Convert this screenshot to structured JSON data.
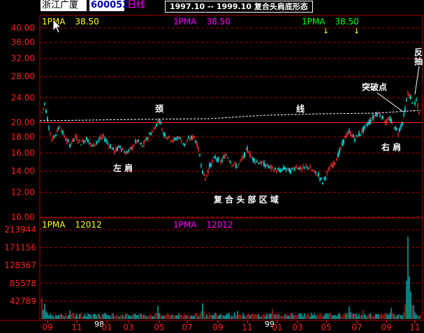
{
  "header": {
    "stock_name": "浙江广厦",
    "stock_code": "600052",
    "period": "日线",
    "range_title": "1997.10  --  1999.10   复合头肩底形态"
  },
  "colors": {
    "up": "#ff3030",
    "down": "#00ffff",
    "grid": "#aa0000",
    "ma_yellow": "#ffff00",
    "ma_magenta": "#ff00ff",
    "ma_green": "#00ff00"
  },
  "chart_data": [
    {
      "type": "candlestick",
      "y_ticks": [
        "40.00",
        "36.00",
        "32.00",
        "28.00",
        "24.00",
        "20.00",
        "18.00",
        "16.00",
        "14.00",
        "12.00",
        "10.00"
      ],
      "y_values": [
        40,
        36,
        32,
        28,
        24,
        20,
        18,
        16,
        14,
        12,
        10
      ],
      "scale": "log",
      "ylim": [
        10,
        40
      ],
      "ma_labels": [
        {
          "name": "1PMA",
          "value": "38.50",
          "color": "yellow"
        },
        {
          "name": "1PMA",
          "value": "38.50",
          "color": "magenta"
        },
        {
          "name": "1PMA",
          "value": "38.50",
          "color": "green"
        }
      ],
      "neckline_label_1": "颈",
      "neckline_label_2": "线",
      "annotations": {
        "left_shoulder": "左 肩",
        "right_shoulder": "右 肩",
        "compound_head": "复 合 头 部 区 域",
        "breakout": "突破点",
        "pullback": "反抽"
      },
      "approx_price_path": [
        [
          0,
          21.5
        ],
        [
          4,
          23.0
        ],
        [
          9,
          20.0
        ],
        [
          14,
          17.5
        ],
        [
          20,
          18.5
        ],
        [
          26,
          19.5
        ],
        [
          32,
          18.0
        ],
        [
          40,
          17.0
        ],
        [
          48,
          18.0
        ],
        [
          56,
          17.2
        ],
        [
          64,
          17.8
        ],
        [
          72,
          16.8
        ],
        [
          80,
          17.5
        ],
        [
          88,
          18.0
        ],
        [
          96,
          17.0
        ],
        [
          104,
          16.2
        ],
        [
          112,
          16.8
        ],
        [
          120,
          16.0
        ],
        [
          128,
          16.5
        ],
        [
          136,
          17.5
        ],
        [
          144,
          16.8
        ],
        [
          152,
          18.0
        ],
        [
          160,
          19.0
        ],
        [
          168,
          20.5
        ],
        [
          174,
          18.5
        ],
        [
          180,
          18.0
        ],
        [
          188,
          17.5
        ],
        [
          196,
          18.0
        ],
        [
          204,
          17.0
        ],
        [
          212,
          17.8
        ],
        [
          218,
          18.0
        ],
        [
          224,
          16.5
        ],
        [
          230,
          14.0
        ],
        [
          234,
          13.2
        ],
        [
          240,
          14.5
        ],
        [
          248,
          15.5
        ],
        [
          256,
          15.0
        ],
        [
          264,
          15.8
        ],
        [
          272,
          14.8
        ],
        [
          280,
          14.5
        ],
        [
          288,
          15.5
        ],
        [
          294,
          16.5
        ],
        [
          300,
          15.5
        ],
        [
          308,
          15.0
        ],
        [
          316,
          14.8
        ],
        [
          324,
          14.5
        ],
        [
          332,
          14.2
        ],
        [
          340,
          14.0
        ],
        [
          348,
          14.3
        ],
        [
          356,
          14.0
        ],
        [
          364,
          14.5
        ],
        [
          372,
          14.2
        ],
        [
          380,
          14.5
        ],
        [
          388,
          14.0
        ],
        [
          396,
          13.6
        ],
        [
          402,
          12.9
        ],
        [
          408,
          13.8
        ],
        [
          414,
          14.5
        ],
        [
          420,
          15.0
        ],
        [
          428,
          16.5
        ],
        [
          434,
          18.0
        ],
        [
          440,
          18.6
        ],
        [
          448,
          17.8
        ],
        [
          456,
          18.5
        ],
        [
          464,
          19.5
        ],
        [
          472,
          20.5
        ],
        [
          480,
          21.5
        ],
        [
          486,
          21.0
        ],
        [
          492,
          20.0
        ],
        [
          498,
          20.5
        ],
        [
          504,
          19.5
        ],
        [
          510,
          18.6
        ],
        [
          516,
          20.0
        ],
        [
          520,
          22.0
        ],
        [
          524,
          24.8
        ],
        [
          528,
          24.0
        ],
        [
          532,
          22.0
        ],
        [
          536,
          23.5
        ],
        [
          540,
          21.5
        ],
        [
          543,
          21.8
        ]
      ]
    },
    {
      "type": "bar",
      "y_ticks": [
        "213944",
        "171156",
        "128367",
        "85578",
        "42789"
      ],
      "y_values": [
        213944,
        171156,
        128367,
        85578,
        42789
      ],
      "ylim": [
        0,
        213944
      ],
      "ma_labels": [
        {
          "name": "1PMA",
          "value": "12012",
          "color": "yellow"
        },
        {
          "name": "1PMA",
          "value": "12012",
          "color": "magenta"
        }
      ],
      "x_ticks": [
        "09",
        "11",
        "98",
        "01",
        "03",
        "05",
        "07",
        "09",
        "11",
        "99",
        "01",
        "03",
        "05",
        "07",
        "09",
        "11"
      ],
      "volume_peaks": [
        [
          0,
          55000
        ],
        [
          4,
          40000
        ],
        [
          40,
          25000
        ],
        [
          80,
          15000
        ],
        [
          120,
          14000
        ],
        [
          166,
          35000
        ],
        [
          230,
          40000
        ],
        [
          280,
          20000
        ],
        [
          330,
          28000
        ],
        [
          400,
          12000
        ],
        [
          440,
          35000
        ],
        [
          460,
          25000
        ],
        [
          500,
          30000
        ],
        [
          520,
          40000
        ],
        [
          524,
          210000
        ],
        [
          528,
          80000
        ],
        [
          532,
          40000
        ]
      ]
    }
  ]
}
